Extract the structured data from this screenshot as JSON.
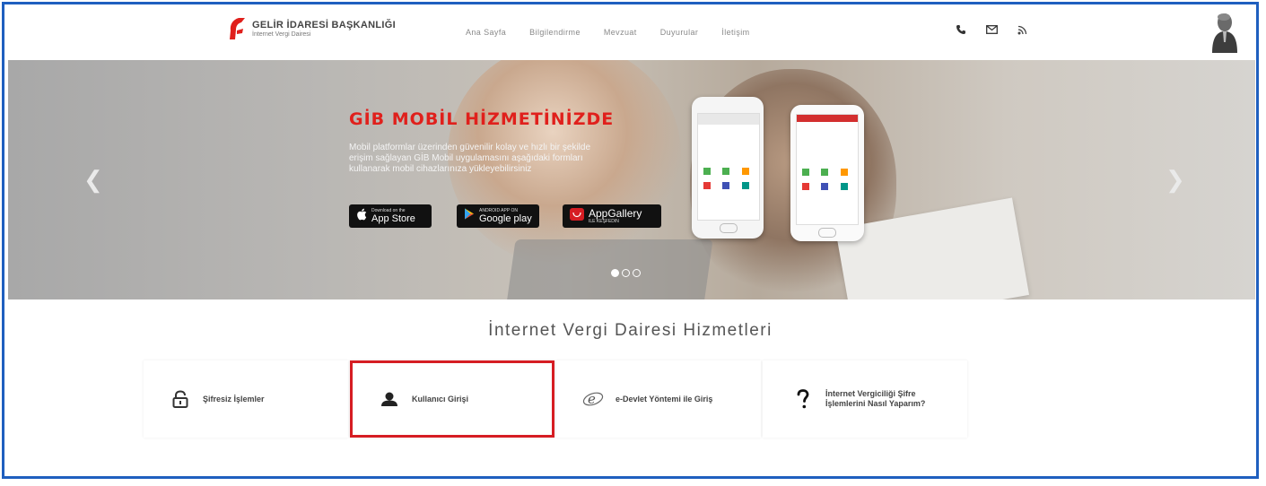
{
  "header": {
    "logo_title": "GELİR İDARESİ BAŞKANLIĞI",
    "logo_subtitle": "İnternet Vergi Dairesi",
    "nav": [
      "Ana Sayfa",
      "Bilgilendirme",
      "Mevzuat",
      "Duyurular",
      "İletişim"
    ],
    "icons": [
      "phone-icon",
      "mail-icon",
      "rss-icon"
    ]
  },
  "hero": {
    "title": "GİB MOBİL HİZMETİNİZDE",
    "text": "Mobil platformlar üzerinden güvenilir kolay ve hızlı bir şekilde erişim sağlayan GİB Mobil uygulamasını aşağıdaki formları kullanarak mobil cihazlarınıza yükleyebilirsiniz",
    "stores": [
      {
        "small": "Download on the",
        "big": "App Store"
      },
      {
        "small": "ANDROID APP ON",
        "big": "Google play"
      },
      {
        "small": "ILE KEŞFEDIN",
        "big": "AppGallery"
      }
    ],
    "slides": 3,
    "active_slide": 1
  },
  "services": {
    "title": "İnternet Vergi Dairesi Hizmetleri",
    "cards": [
      {
        "label": "Şifresiz İşlemler",
        "icon": "unlock-icon"
      },
      {
        "label": "Kullanıcı Girişi",
        "icon": "user-icon"
      },
      {
        "label": "e-Devlet Yöntemi ile Giriş",
        "icon": "e-devlet-icon"
      },
      {
        "label": "İnternet Vergiciliği Şifre İşlemlerini Nasıl Yaparım?",
        "icon": "question-icon"
      }
    ]
  },
  "colors": {
    "frame": "#1f5fbf",
    "brand_red": "#e0201c",
    "active_border": "#d61d23"
  }
}
